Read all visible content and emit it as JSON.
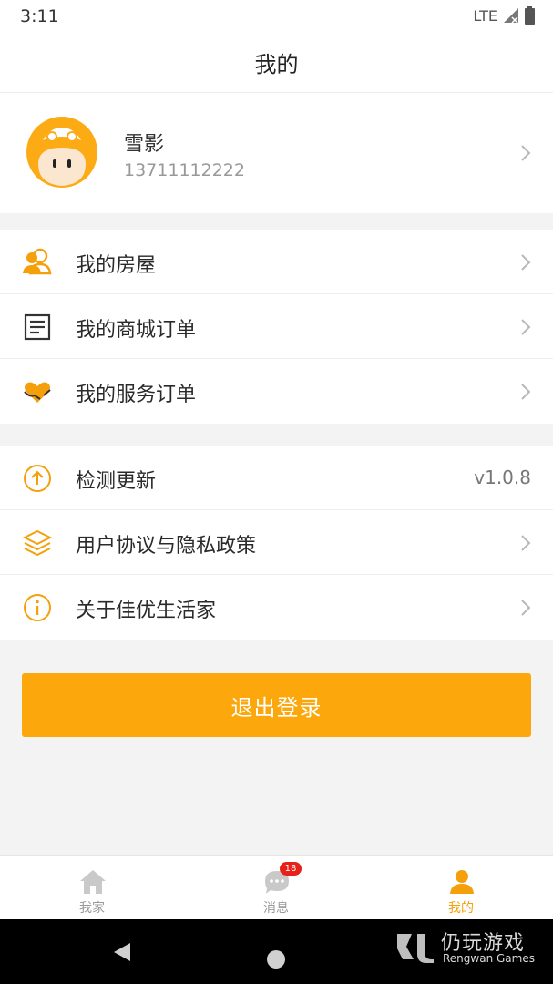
{
  "status_bar": {
    "time": "3:11",
    "network": "LTE"
  },
  "header": {
    "title": "我的"
  },
  "profile": {
    "name": "雪影",
    "phone": "13711112222"
  },
  "menu_group_1": [
    {
      "label": "我的房屋",
      "icon": "people-icon"
    },
    {
      "label": "我的商城订单",
      "icon": "document-list-icon"
    },
    {
      "label": "我的服务订单",
      "icon": "heart-hands-icon"
    }
  ],
  "menu_group_2": [
    {
      "label": "检测更新",
      "icon": "arrow-up-circle-icon",
      "value": "v1.0.8"
    },
    {
      "label": "用户协议与隐私政策",
      "icon": "layers-icon"
    },
    {
      "label": "关于佳优生活家",
      "icon": "info-circle-icon"
    }
  ],
  "logout": {
    "label": "退出登录"
  },
  "tabbar": {
    "items": [
      {
        "label": "我家",
        "icon": "home-icon"
      },
      {
        "label": "消息",
        "icon": "chat-icon",
        "badge": "18"
      },
      {
        "label": "我的",
        "icon": "person-icon"
      }
    ]
  },
  "watermark": {
    "title": "仍玩游戏",
    "subtitle": "Rengwan Games"
  },
  "colors": {
    "accent": "#fca70b",
    "badge": "#e8201a",
    "background": "#f3f3f3"
  }
}
